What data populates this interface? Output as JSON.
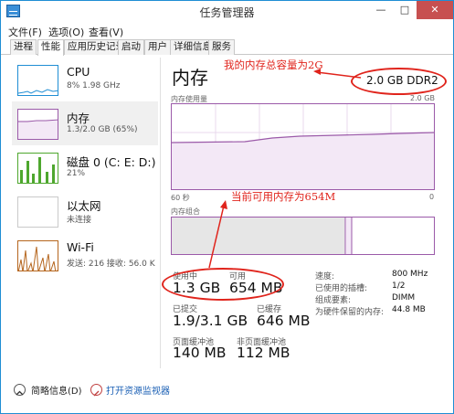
{
  "window": {
    "title": "任务管理器"
  },
  "menu": [
    "文件(F)",
    "选项(O)",
    "查看(V)"
  ],
  "tabs": [
    "进程",
    "性能",
    "应用历史记录",
    "启动",
    "用户",
    "详细信息",
    "服务"
  ],
  "sidebar": [
    {
      "title": "CPU",
      "sub": "8% 1.98 GHz"
    },
    {
      "title": "内存",
      "sub": "1.3/2.0 GB (65%)"
    },
    {
      "title": "磁盘 0 (C: E: D:)",
      "sub": "21%"
    },
    {
      "title": "以太网",
      "sub": "未连接"
    },
    {
      "title": "Wi-Fi",
      "sub": "发送: 216 接收: 56.0 K"
    }
  ],
  "main": {
    "title": "内存",
    "spec": "2.0 GB DDR2",
    "usage_label": "内存使用量",
    "usage_max": "2.0 GB",
    "time_left": "60 秒",
    "time_right": "0",
    "composition_label": "内存组合",
    "stats": {
      "in_use_label": "使用中",
      "in_use": "1.3 GB",
      "available_label": "可用",
      "available": "654 MB",
      "committed_label": "已提交",
      "committed": "1.9/3.1 GB",
      "cached_label": "已缓存",
      "cached": "646 MB",
      "paged_label": "页面缓冲池",
      "paged": "140 MB",
      "nonpaged_label": "非页面缓冲池",
      "nonpaged": "112 MB"
    },
    "kv": [
      {
        "label": "速度:",
        "value": "800 MHz"
      },
      {
        "label": "已使用的插槽:",
        "value": "1/2"
      },
      {
        "label": "组成要素:",
        "value": "DIMM"
      },
      {
        "label": "为硬件保留的内存:",
        "value": "44.8 MB"
      }
    ]
  },
  "annotations": {
    "capacity": "我的内存总容量为2G",
    "available": "当前可用内存为654M"
  },
  "footer": {
    "less_details": "简略信息(D)",
    "resource_monitor": "打开资源监视器"
  },
  "colors": {
    "memory_line": "#9b5aa9",
    "disk_line": "#4ea72e",
    "cpu_line": "#1f8ed4",
    "wifi_line": "#b5651d",
    "annotation": "#e0241c"
  }
}
